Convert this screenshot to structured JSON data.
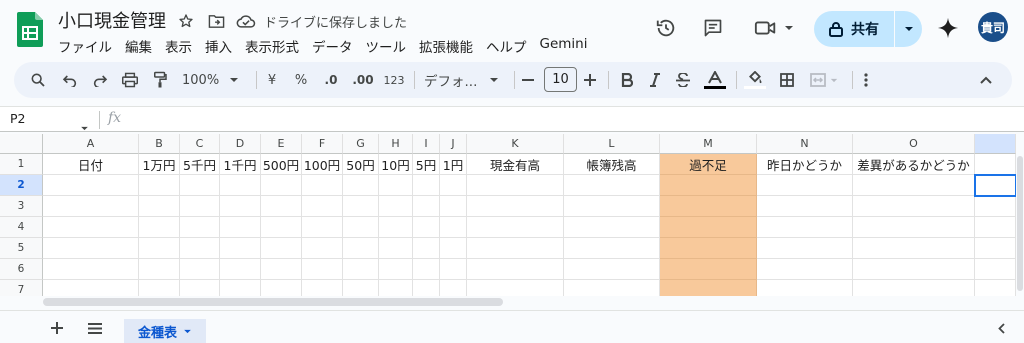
{
  "app": {
    "title": "小口現金管理",
    "save_status": "ドライブに保存しました",
    "menu": [
      "ファイル",
      "編集",
      "表示",
      "挿入",
      "表示形式",
      "データ",
      "ツール",
      "拡張機能",
      "ヘルプ",
      "Gemini"
    ],
    "share_label": "共有",
    "avatar_text": "貴司"
  },
  "toolbar": {
    "zoom": "100%",
    "currency": "¥",
    "percent": "%",
    "dec_decrease": ".0",
    "dec_increase": ".00",
    "number_format": "123",
    "font": "デフォ...",
    "font_size": "10"
  },
  "formula_bar": {
    "name_box": "P2",
    "fx_label": "fx"
  },
  "sheet": {
    "columns": [
      "A",
      "B",
      "C",
      "D",
      "E",
      "F",
      "G",
      "H",
      "I",
      "J",
      "K",
      "L",
      "M",
      "N",
      "O"
    ],
    "rows": [
      "1",
      "2",
      "3",
      "4",
      "5",
      "6",
      "7"
    ],
    "header_row": [
      "日付",
      "1万円",
      "5千円",
      "1千円",
      "500円",
      "100円",
      "50円",
      "10円",
      "5円",
      "1円",
      "現金有高",
      "帳簿残高",
      "過不足",
      "昨日かどうか",
      "差異があるかどうか"
    ],
    "highlight_color": "#f8c99b",
    "selected_cell": "P2"
  },
  "tabs": {
    "active_tab": "金種表"
  }
}
